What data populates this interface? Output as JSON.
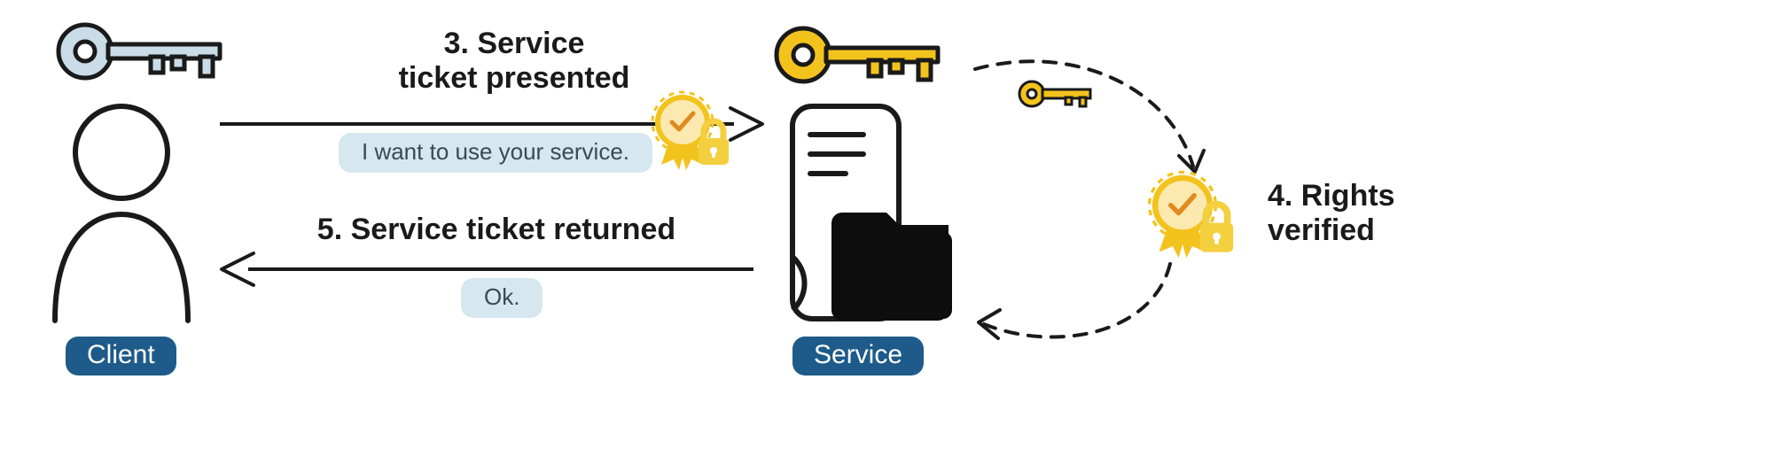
{
  "actors": {
    "client_label": "Client",
    "service_label": "Service"
  },
  "steps": {
    "s3_line1": "3. Service",
    "s3_line2": "ticket presented",
    "s3_bubble": "I want to use your service.",
    "s4_line1": "4. Rights",
    "s4_line2": "verified",
    "s5_title": "5. Service ticket returned",
    "s5_bubble": "Ok."
  },
  "colors": {
    "badge_bg": "#1e5b8a",
    "bubble_bg": "#d6e7ef",
    "key_blue": "#c9dce8",
    "key_gold": "#f3c31d",
    "ribbon_gold": "#f3c31d",
    "ribbon_fill": "#fbe9b0",
    "lock_gold": "#f4cf3e"
  },
  "icons": {
    "client_key": "key-icon",
    "service_key": "key-icon",
    "ticket_badge": "certificate-lock-icon",
    "person": "person-icon",
    "server": "server-folder-icon"
  }
}
